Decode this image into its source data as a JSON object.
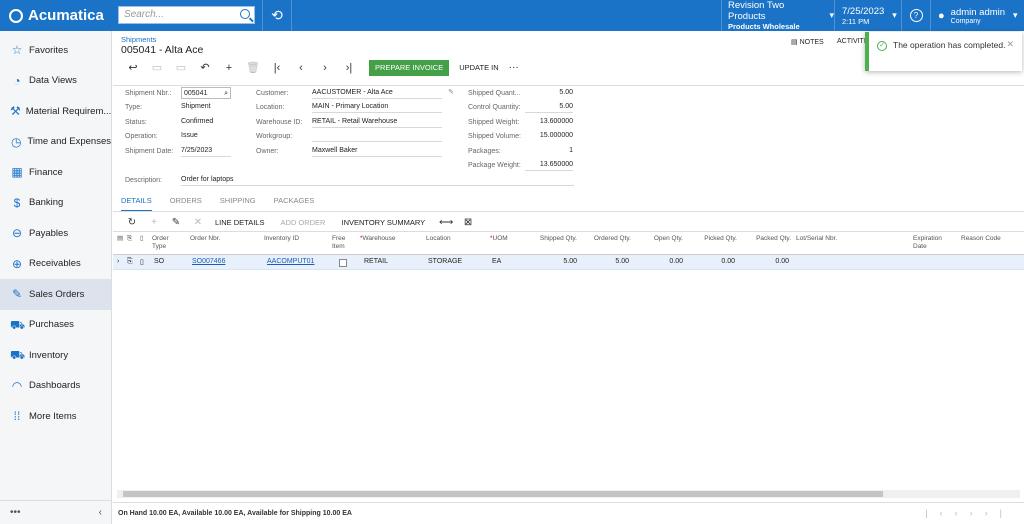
{
  "app": {
    "brand": "Acumatica"
  },
  "search": {
    "placeholder": "Search..."
  },
  "header": {
    "branch_line1": "Revision Two Products",
    "branch_line2": "Products Wholesale",
    "date": "7/25/2023",
    "time": "2:11 PM",
    "user_name": "admin admin",
    "user_company": "Company"
  },
  "sidebar": {
    "items": [
      {
        "label": "Favorites",
        "icon": "star-icon"
      },
      {
        "label": "Data Views",
        "icon": "pie-chart-icon"
      },
      {
        "label": "Material Requirem...",
        "icon": "hammer-icon"
      },
      {
        "label": "Time and Expenses",
        "icon": "clock-icon"
      },
      {
        "label": "Finance",
        "icon": "calculator-icon"
      },
      {
        "label": "Banking",
        "icon": "dollar-icon"
      },
      {
        "label": "Payables",
        "icon": "minus-circle-icon"
      },
      {
        "label": "Receivables",
        "icon": "plus-circle-icon"
      },
      {
        "label": "Sales Orders",
        "icon": "edit-icon"
      },
      {
        "label": "Purchases",
        "icon": "cart-icon"
      },
      {
        "label": "Inventory",
        "icon": "truck-icon"
      },
      {
        "label": "Dashboards",
        "icon": "gauge-icon"
      },
      {
        "label": "More Items",
        "icon": "grid-icon"
      }
    ],
    "footer_more": "•••",
    "footer_collapse": "‹"
  },
  "page": {
    "breadcrumb": "Shipments",
    "title": "005041 - Alta Ace",
    "notes": "NOTES",
    "activities": "ACTIVITI"
  },
  "toast": {
    "message": "The operation has completed."
  },
  "toolbar": {
    "prepare_invoice": "PREPARE INVOICE",
    "update_in": "UPDATE IN",
    "more": "···"
  },
  "form": {
    "shipment_nbr_label": "Shipment Nbr.:",
    "shipment_nbr": "005041",
    "type_label": "Type:",
    "type": "Shipment",
    "status_label": "Status:",
    "status": "Confirmed",
    "operation_label": "Operation:",
    "operation": "Issue",
    "shipment_date_label": "Shipment Date:",
    "shipment_date": "7/25/2023",
    "customer_label": "Customer:",
    "customer": "AACUSTOMER - Alta Ace",
    "location_label": "Location:",
    "location": "MAIN - Primary Location",
    "warehouse_label": "Warehouse ID:",
    "warehouse": "RETAIL - Retail Warehouse",
    "workgroup_label": "Workgroup:",
    "workgroup": "",
    "owner_label": "Owner:",
    "owner": "Maxwell Baker",
    "description_label": "Description:",
    "description": "Order for laptops",
    "shipped_qty_label": "Shipped Quant...",
    "shipped_qty": "5.00",
    "control_qty_label": "Control Quantity:",
    "control_qty": "5.00",
    "shipped_weight_label": "Shipped Weight:",
    "shipped_weight": "13.600000",
    "shipped_volume_label": "Shipped Volume:",
    "shipped_volume": "15.000000",
    "packages_label": "Packages:",
    "packages": "1",
    "package_weight_label": "Package Weight:",
    "package_weight": "13.650000"
  },
  "tabs": [
    "DETAILS",
    "ORDERS",
    "SHIPPING",
    "PACKAGES"
  ],
  "grid_toolbar": {
    "line_details": "LINE DETAILS",
    "add_order": "ADD ORDER",
    "inventory_summary": "INVENTORY SUMMARY"
  },
  "grid": {
    "columns": {
      "order_type": "Order Type",
      "order_nbr": "Order Nbr.",
      "inventory_id": "Inventory ID",
      "free_item": "Free Item",
      "warehouse": "Warehouse",
      "location": "Location",
      "uom": "UOM",
      "shipped_qty": "Shipped Qty.",
      "ordered_qty": "Ordered Qty.",
      "open_qty": "Open Qty.",
      "picked_qty": "Picked Qty.",
      "packed_qty": "Packed Qty.",
      "lot_serial": "Lot/Serial Nbr.",
      "expiration_date": "Expiration Date",
      "reason_code": "Reason Code"
    },
    "row": {
      "order_type": "SO",
      "order_nbr": "SO007466",
      "inventory_id": "AACOMPUT01",
      "warehouse": "RETAIL",
      "location": "STORAGE",
      "uom": "EA",
      "shipped_qty": "5.00",
      "ordered_qty": "5.00",
      "open_qty": "0.00",
      "picked_qty": "0.00",
      "packed_qty": "0.00"
    }
  },
  "status_bar": {
    "text": "On Hand 10.00 EA, Available 10.00 EA, Available for Shipping 10.00 EA"
  },
  "colors": {
    "brand": "#1a73c7",
    "prepare_invoice": "#43a047",
    "toast_border": "#4caf50"
  }
}
